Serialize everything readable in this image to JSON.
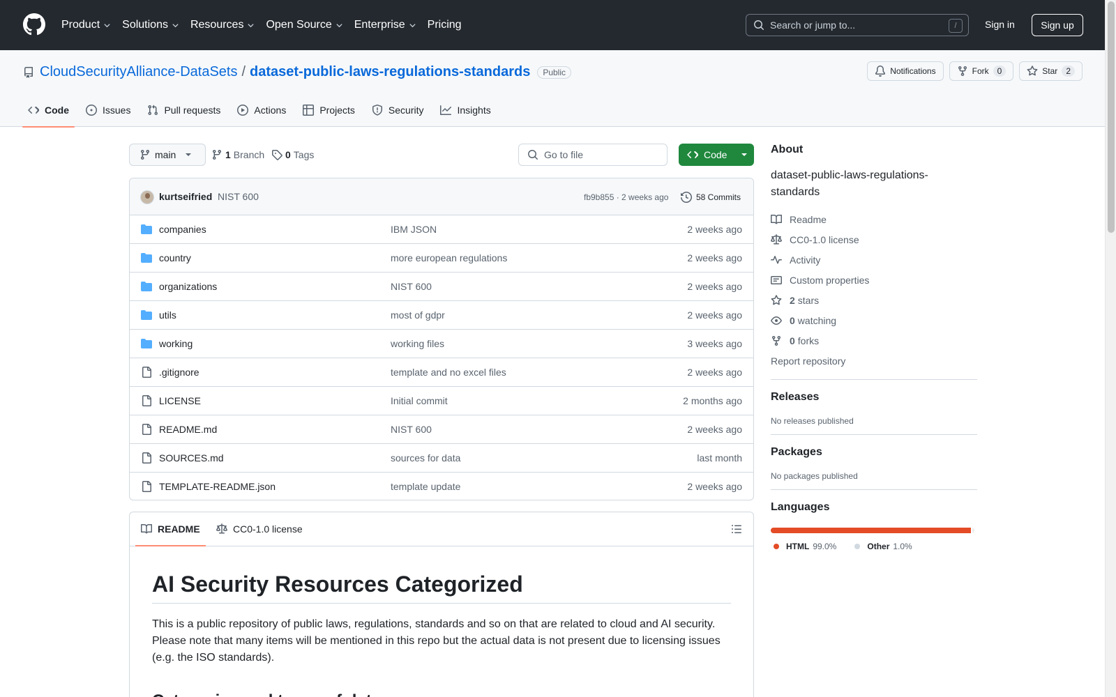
{
  "header": {
    "nav": [
      {
        "label": "Product",
        "dropdown": true
      },
      {
        "label": "Solutions",
        "dropdown": true
      },
      {
        "label": "Resources",
        "dropdown": true
      },
      {
        "label": "Open Source",
        "dropdown": true
      },
      {
        "label": "Enterprise",
        "dropdown": true
      },
      {
        "label": "Pricing",
        "dropdown": false
      }
    ],
    "search_placeholder": "Search or jump to...",
    "search_shortcut": "/",
    "sign_in": "Sign in",
    "sign_up": "Sign up"
  },
  "repo": {
    "owner": "CloudSecurityAlliance-DataSets",
    "separator": "/",
    "name": "dataset-public-laws-regulations-standards",
    "visibility": "Public",
    "notifications_label": "Notifications",
    "fork_label": "Fork",
    "fork_count": "0",
    "star_label": "Star",
    "star_count": "2"
  },
  "tabs": [
    {
      "label": "Code",
      "icon": "code-icon",
      "active": true
    },
    {
      "label": "Issues",
      "icon": "issue-icon",
      "active": false
    },
    {
      "label": "Pull requests",
      "icon": "pull-request-icon",
      "active": false
    },
    {
      "label": "Actions",
      "icon": "play-icon",
      "active": false
    },
    {
      "label": "Projects",
      "icon": "table-icon",
      "active": false
    },
    {
      "label": "Security",
      "icon": "shield-icon",
      "active": false
    },
    {
      "label": "Insights",
      "icon": "graph-icon",
      "active": false
    }
  ],
  "branchbar": {
    "branch": "main",
    "branch_count": "1",
    "branch_label": "Branch",
    "tag_count": "0",
    "tag_label": "Tags",
    "goto_placeholder": "Go to file",
    "code_button": "Code"
  },
  "latest_commit": {
    "user": "kurtseifried",
    "message": "NIST 600",
    "meta": "fb9b855 · 2 weeks ago",
    "commits": "58 Commits"
  },
  "files": [
    {
      "name": "companies",
      "type": "folder",
      "message": "IBM JSON",
      "date": "2 weeks ago"
    },
    {
      "name": "country",
      "type": "folder",
      "message": "more european regulations",
      "date": "2 weeks ago"
    },
    {
      "name": "organizations",
      "type": "folder",
      "message": "NIST 600",
      "date": "2 weeks ago"
    },
    {
      "name": "utils",
      "type": "folder",
      "message": "most of gdpr",
      "date": "2 weeks ago"
    },
    {
      "name": "working",
      "type": "folder",
      "message": "working files",
      "date": "3 weeks ago"
    },
    {
      "name": ".gitignore",
      "type": "file",
      "message": "template and no excel files",
      "date": "2 weeks ago"
    },
    {
      "name": "LICENSE",
      "type": "file",
      "message": "Initial commit",
      "date": "2 months ago"
    },
    {
      "name": "README.md",
      "type": "file",
      "message": "NIST 600",
      "date": "2 weeks ago"
    },
    {
      "name": "SOURCES.md",
      "type": "file",
      "message": "sources for data",
      "date": "last month"
    },
    {
      "name": "TEMPLATE-README.json",
      "type": "file",
      "message": "template update",
      "date": "2 weeks ago"
    }
  ],
  "readme": {
    "tab_readme": "README",
    "tab_license": "CC0-1.0 license",
    "title": "AI Security Resources Categorized",
    "paragraph": "This is a public repository of public laws, regulations, standards and so on that are related to cloud and AI security. Please note that many items will be mentioned in this repo but the actual data is not present due to licensing issues (e.g. the ISO standards).",
    "subheading": "Categories and types of data:"
  },
  "about": {
    "heading": "About",
    "description": "dataset-public-laws-regulations-standards",
    "links": [
      {
        "icon": "book-icon",
        "strong": "",
        "label": "Readme"
      },
      {
        "icon": "law-icon",
        "strong": "",
        "label": "CC0-1.0 license"
      },
      {
        "icon": "pulse-icon",
        "strong": "",
        "label": "Activity"
      },
      {
        "icon": "note-icon",
        "strong": "",
        "label": "Custom properties"
      },
      {
        "icon": "star-icon",
        "strong": "2",
        "label": "stars"
      },
      {
        "icon": "eye-icon",
        "strong": "0",
        "label": "watching"
      },
      {
        "icon": "fork-icon",
        "strong": "0",
        "label": "forks"
      }
    ],
    "report": "Report repository"
  },
  "releases": {
    "heading": "Releases",
    "text": "No releases published"
  },
  "packages": {
    "heading": "Packages",
    "text": "No packages published"
  },
  "languages": {
    "heading": "Languages",
    "items": [
      {
        "name": "HTML",
        "percent": "99.0%",
        "value": 99.0,
        "color": "#e34c26"
      },
      {
        "name": "Other",
        "percent": "1.0%",
        "value": 1.0,
        "color": "#ededed"
      }
    ]
  }
}
